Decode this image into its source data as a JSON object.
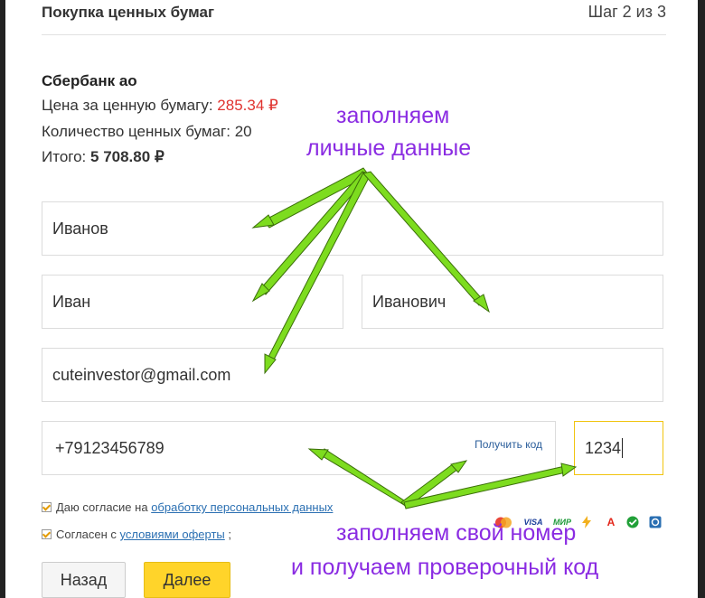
{
  "header": {
    "title": "Покупка ценных бумаг",
    "step": "Шаг 2 из 3"
  },
  "security": {
    "company": "Сбербанк ао",
    "price_label": "Цена за ценную бумагу:",
    "price_value": "285.34",
    "currency_sign": "₽",
    "quantity_label": "Количество ценных бумаг:",
    "quantity_value": "20",
    "total_label": "Итого:",
    "total_value": "5 708.80",
    "total_currency": "₽"
  },
  "form": {
    "last_name": "Иванов",
    "first_name": "Иван",
    "middle_name": "Иванович",
    "email": "cuteinvestor@gmail.com",
    "phone": "+79123456789",
    "get_code_label": "Получить код",
    "code": "1234"
  },
  "consents": {
    "personal_prefix": "Даю согласие на",
    "personal_link": "обработку персональных данных",
    "offer_prefix": "Согласен с",
    "offer_link": "условиями оферты",
    "offer_suffix": ";"
  },
  "buttons": {
    "back": "Назад",
    "next": "Далее"
  },
  "payment_icons": {
    "visa": "VISA",
    "mir": "МИР",
    "alfa": "А"
  },
  "annotations": {
    "top_line1": "заполняем",
    "top_line2": "личные данные",
    "bottom_line1": "заполняем свой номер",
    "bottom_line2": "и получаем проверочный код"
  },
  "colors": {
    "accent_yellow": "#ffd42a",
    "price_red": "#e0332f",
    "annotation_purple": "#8a2be2",
    "arrow_green": "#7ddc1f",
    "link_blue": "#2a6fb2"
  }
}
